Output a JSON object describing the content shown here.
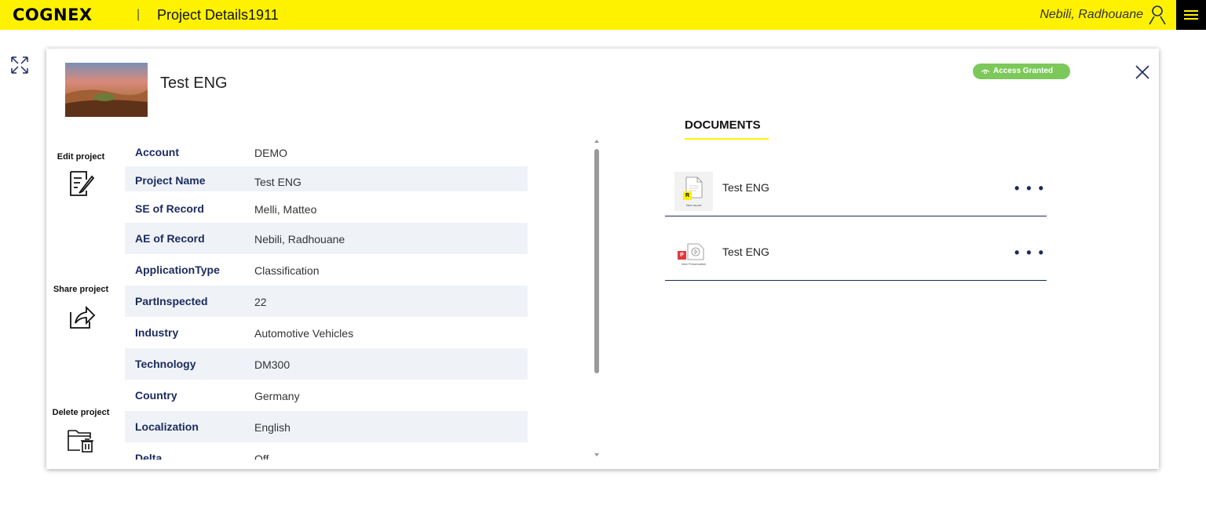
{
  "header": {
    "logo": "COGNEX",
    "separator": "|",
    "title": "Project Details1911",
    "user_name": "Nebili, Radhouane",
    "brand_color": "#fff200"
  },
  "project": {
    "title": "Test ENG",
    "access_badge": "Access Granted"
  },
  "actions": {
    "edit": "Edit project",
    "share": "Share project",
    "delete": "Delete project"
  },
  "details": [
    {
      "key": "Account",
      "value": "DEMO"
    },
    {
      "key": "Project Name",
      "value": "Test ENG"
    },
    {
      "key": "SE of Record",
      "value": "Melli, Matteo"
    },
    {
      "key": "AE of Record",
      "value": "Nebili, Radhouane"
    },
    {
      "key": "ApplicationType",
      "value": "Classification"
    },
    {
      "key": "PartInspected",
      "value": "22"
    },
    {
      "key": "Industry",
      "value": "Automotive Vehicles"
    },
    {
      "key": "Technology",
      "value": "DM300"
    },
    {
      "key": "Country",
      "value": "Germany"
    },
    {
      "key": "Localization",
      "value": "English"
    },
    {
      "key": "Delta",
      "value": "Off"
    }
  ],
  "documents": {
    "title": "DOCUMENTS",
    "items": [
      {
        "name": "Test ENG",
        "tag": "R",
        "caption": "New report",
        "more": "• • •",
        "icon": "report-icon"
      },
      {
        "name": "Test ENG",
        "tag": "P",
        "caption": "New Presentation",
        "more": "• • •",
        "icon": "presentation-icon"
      }
    ]
  },
  "colors": {
    "accent_navy": "#1b2a5e",
    "badge_green": "#7cc85a",
    "row_alt": "#eff3f8"
  }
}
